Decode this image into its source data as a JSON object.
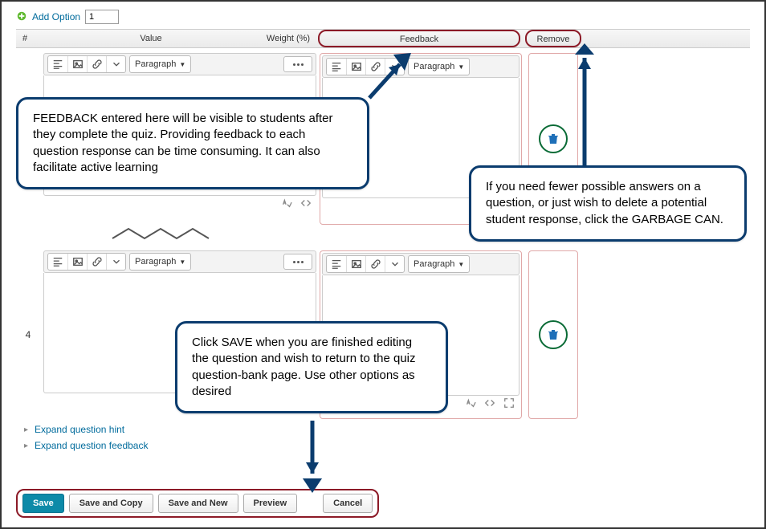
{
  "add_option": {
    "label": "Add Option",
    "value": "1"
  },
  "columns": {
    "hash": "#",
    "value": "Value",
    "weight": "Weight (%)",
    "feedback": "Feedback",
    "remove": "Remove"
  },
  "editor": {
    "paragraph_label": "Paragraph"
  },
  "rows": {
    "second_number": "4"
  },
  "expand": {
    "hint": "Expand question hint",
    "feedback": "Expand question feedback"
  },
  "buttons": {
    "save": "Save",
    "save_copy": "Save and Copy",
    "save_new": "Save and New",
    "preview": "Preview",
    "cancel": "Cancel"
  },
  "callouts": {
    "feedback": "FEEDBACK entered here will be visible to students after they complete the quiz. Providing feedback to each question response can be time consuming. It can also facilitate active learning",
    "garbage": "If you need fewer possible answers on a question, or just wish to delete a potential student response, click the GARBAGE CAN.",
    "save": "Click SAVE when you are finished editing the question and wish to return to the quiz question-bank page. Use other options as desired"
  }
}
